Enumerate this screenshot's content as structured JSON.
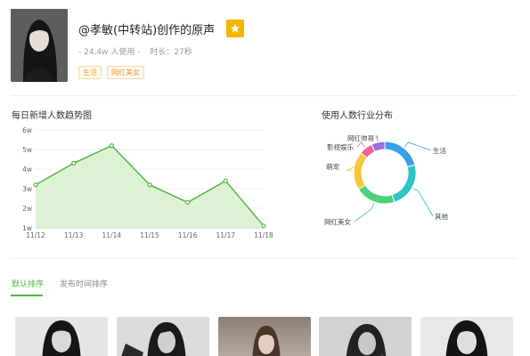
{
  "sound": {
    "title": "@孝敏(中转站)创作的原声",
    "users": "- 24.4w 人使用 -",
    "duration": "时长：27秒",
    "tags": [
      "生活",
      "网红美女"
    ]
  },
  "cover_icon": "portrait-photo",
  "fav_icon": "star-icon",
  "trend": {
    "title": "每日新增人数趋势图"
  },
  "distribution": {
    "title": "使用人数行业分布"
  },
  "tabs": [
    "默认排序",
    "发布时间排序"
  ],
  "thumbnails": [
    "portrait-photo",
    "portrait-photo",
    "portrait-photo",
    "portrait-photo",
    "portrait-photo"
  ],
  "colors": {
    "accent": "#52b742",
    "fav": "#f6b500",
    "tag": "#e6a23c"
  },
  "chart_data": [
    {
      "type": "area",
      "title": "每日新增人数趋势图",
      "categories": [
        "11/12",
        "11/13",
        "11/14",
        "11/15",
        "11/16",
        "11/17",
        "11/18"
      ],
      "values": [
        3.2,
        4.3,
        5.2,
        3.2,
        2.3,
        3.4,
        1.1
      ],
      "yticks": [
        "1w",
        "2w",
        "3w",
        "4w",
        "5w",
        "6w"
      ],
      "ylim": [
        1,
        6
      ],
      "color": "#52b742",
      "fill": "#d9f1d0",
      "grid": true
    },
    {
      "type": "pie",
      "title": "使用人数行业分布",
      "donut": true,
      "labels": [
        "生活",
        "其他",
        "网红美女",
        "萌宠",
        "影视娱乐",
        "网红帅哥"
      ],
      "values": [
        21,
        24,
        21,
        20,
        7,
        7
      ],
      "colors": [
        "#3aa0e8",
        "#2ec4c4",
        "#4cd07a",
        "#f6c73a",
        "#f06292",
        "#9c6fe0"
      ]
    }
  ]
}
